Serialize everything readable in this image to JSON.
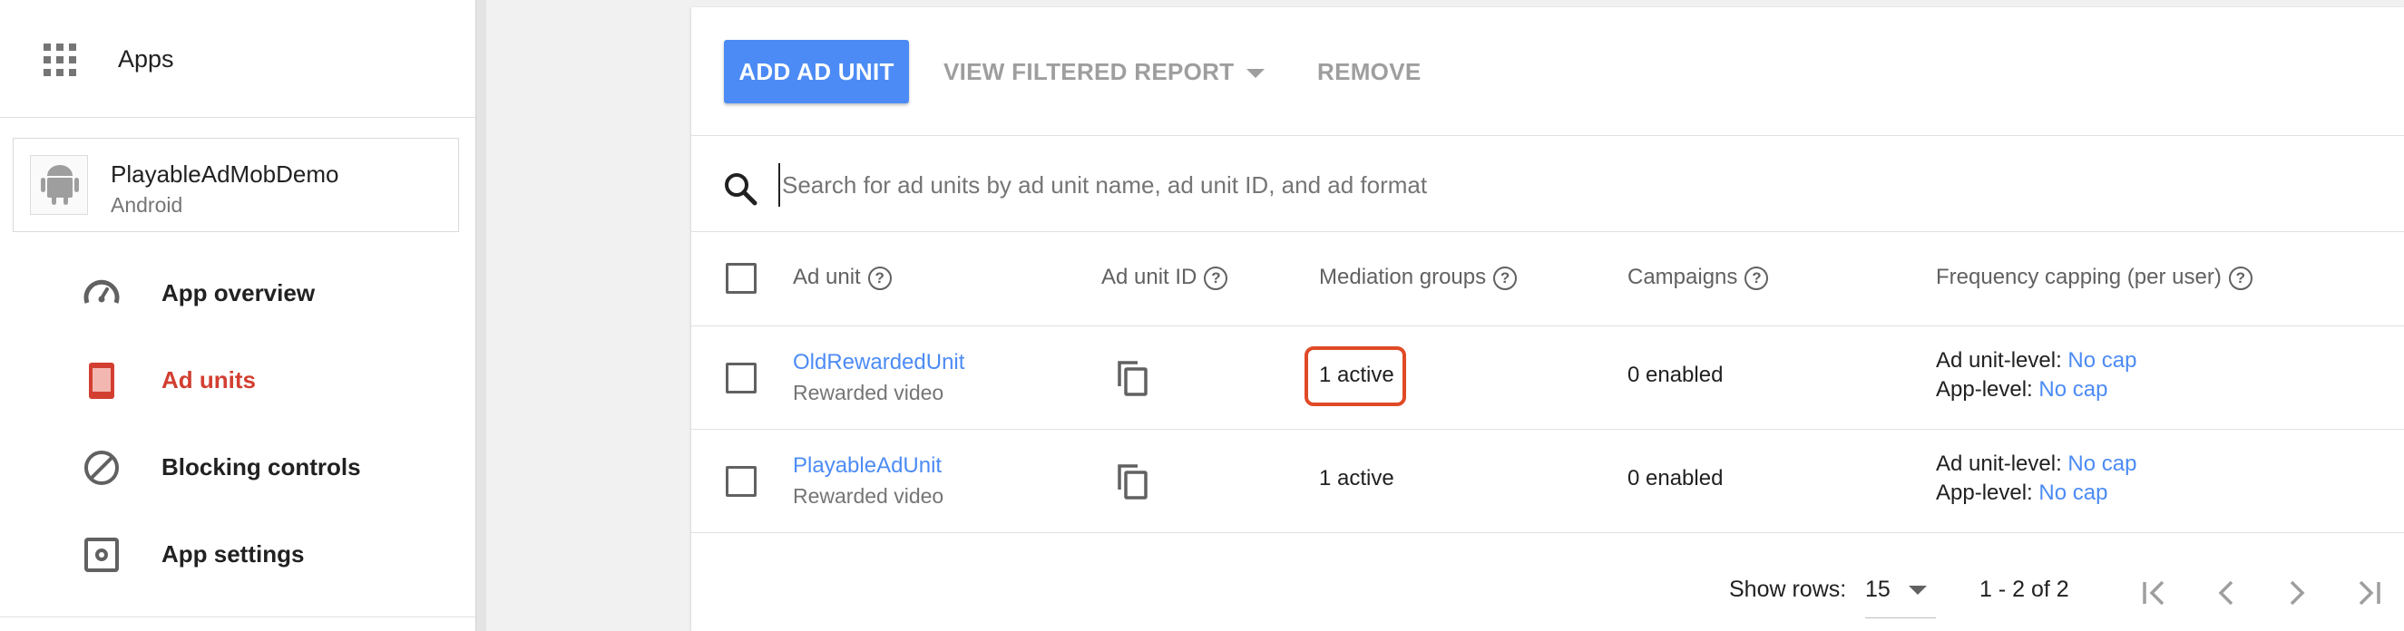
{
  "sidebar": {
    "apps_label": "Apps",
    "app": {
      "name": "PlayableAdMobDemo",
      "platform": "Android"
    },
    "items": [
      {
        "label": "App overview",
        "icon": "speedometer-icon",
        "active": false
      },
      {
        "label": "Ad units",
        "icon": "ad-unit-icon",
        "active": true
      },
      {
        "label": "Blocking controls",
        "icon": "block-icon",
        "active": false
      },
      {
        "label": "App settings",
        "icon": "settings-icon",
        "active": false
      }
    ]
  },
  "toolbar": {
    "add_label": "ADD AD UNIT",
    "filtered_label": "VIEW FILTERED REPORT",
    "remove_label": "REMOVE"
  },
  "search": {
    "placeholder": "Search for ad units by ad unit name, ad unit ID, and ad format",
    "value": ""
  },
  "table": {
    "columns": [
      "Ad unit",
      "Ad unit ID",
      "Mediation groups",
      "Campaigns",
      "Frequency capping (per user)"
    ],
    "rows": [
      {
        "name": "OldRewardedUnit",
        "format": "Rewarded video",
        "mediation": "1 active",
        "campaigns": "0 enabled",
        "ad_unit_level_label": "Ad unit-level:",
        "ad_unit_level_value": "No cap",
        "app_level_label": "App-level:",
        "app_level_value": "No cap"
      },
      {
        "name": "PlayableAdUnit",
        "format": "Rewarded video",
        "mediation": "1 active",
        "campaigns": "0 enabled",
        "ad_unit_level_label": "Ad unit-level:",
        "ad_unit_level_value": "No cap",
        "app_level_label": "App-level:",
        "app_level_value": "No cap"
      }
    ]
  },
  "footer": {
    "show_rows_label": "Show rows:",
    "rows_value": "15",
    "range_text": "1 - 2 of 2"
  },
  "colors": {
    "accent": "#4c8bf5",
    "active_nav": "#d23f31",
    "highlight": "#e04a26"
  }
}
